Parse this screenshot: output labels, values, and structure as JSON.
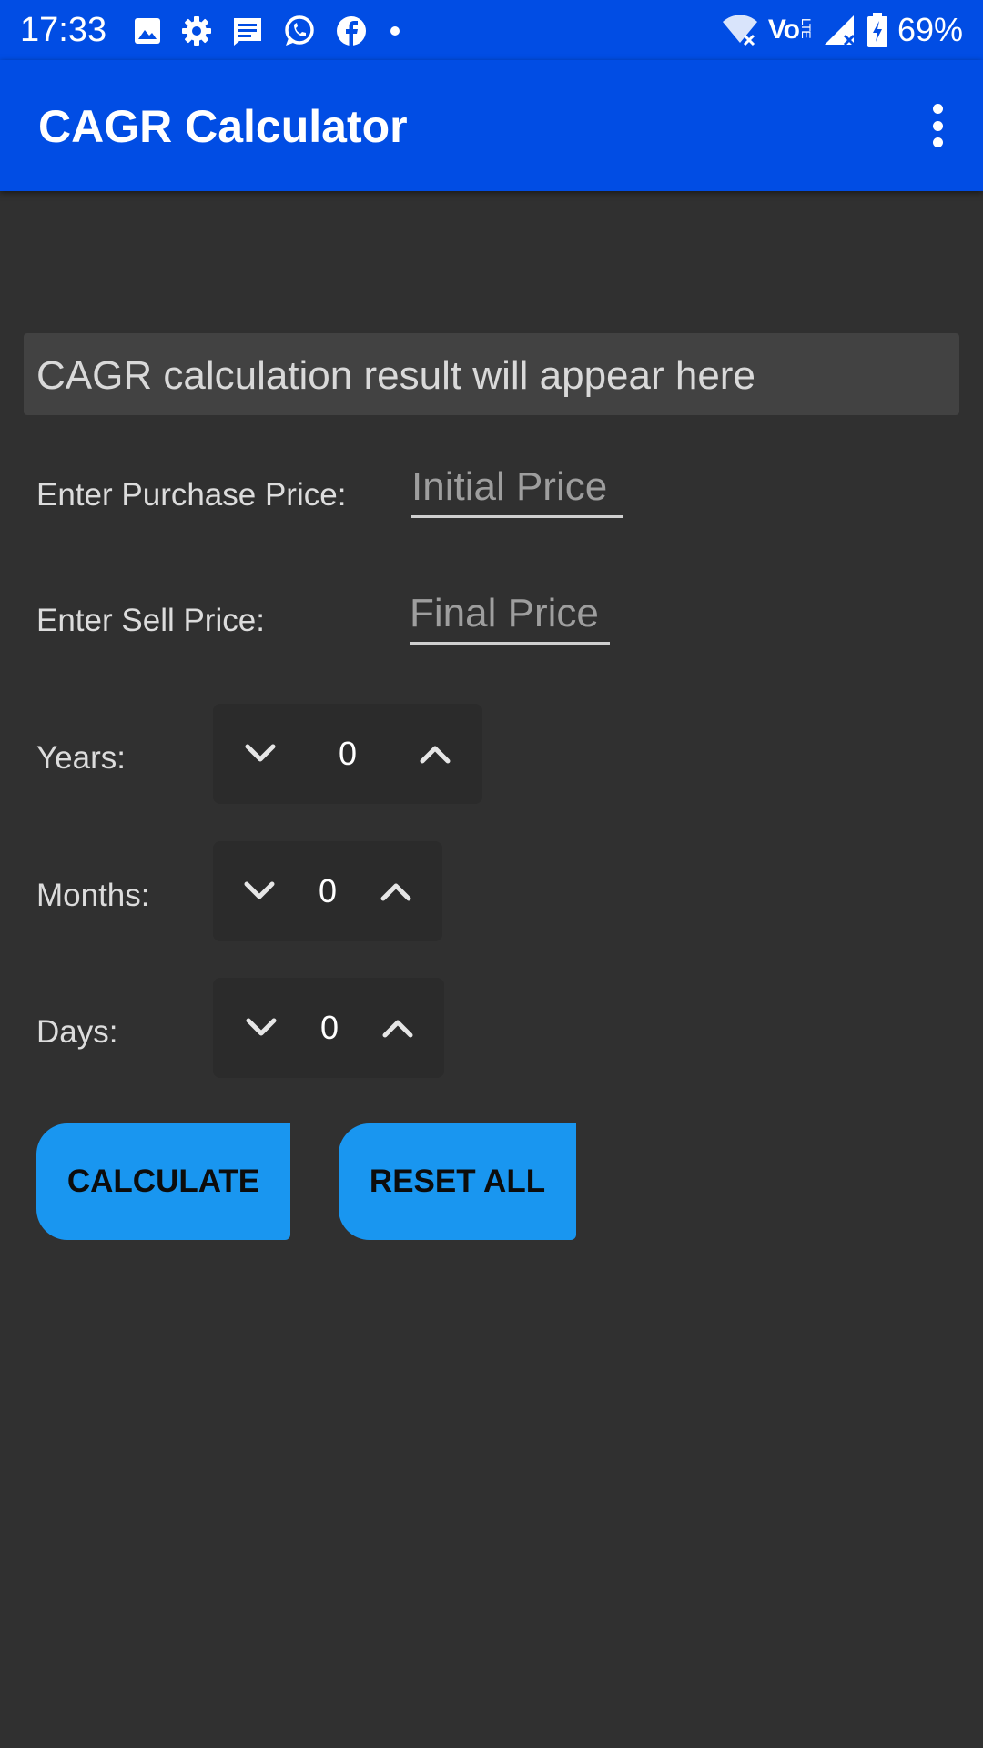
{
  "status_bar": {
    "time": "17:33",
    "battery": "69%",
    "network": "Vo",
    "network_sub": "LTE",
    "left_icons": [
      "gallery-icon",
      "settings-icon",
      "messages-icon",
      "whatsapp-icon",
      "facebook-icon",
      "dot-icon"
    ],
    "right_icons": [
      "wifi-icon",
      "signal-icon",
      "battery-charging-icon"
    ]
  },
  "app_bar": {
    "title": "CAGR Calculator",
    "menu_icon": "more-vertical-icon"
  },
  "result": {
    "text": "CAGR calculation result will appear here"
  },
  "form": {
    "purchase": {
      "label": "Enter Purchase Price:",
      "placeholder": "Initial Price"
    },
    "sell": {
      "label": "Enter Sell Price:",
      "placeholder": "Final Price"
    },
    "years": {
      "label": "Years:",
      "value": "0"
    },
    "months": {
      "label": "Months:",
      "value": "0"
    },
    "days": {
      "label": "Days:",
      "value": "0"
    }
  },
  "actions": {
    "calculate": "CALCULATE",
    "reset": "RESET ALL"
  },
  "colors": {
    "primary": "#014de4",
    "background": "#303030",
    "button": "#1996f0",
    "result_bg": "#424242"
  }
}
